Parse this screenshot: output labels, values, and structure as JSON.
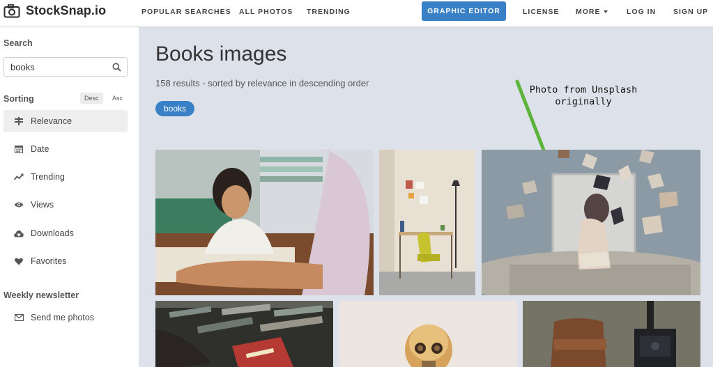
{
  "app": {
    "logo_text": "StockSnap.io"
  },
  "nav": {
    "popular": "POPULAR SEARCHES",
    "all_photos": "ALL PHOTOS",
    "trending": "TRENDING",
    "graphic_editor": "GRAPHIC EDITOR",
    "license": "LICENSE",
    "more": "MORE",
    "login": "LOG IN",
    "signup": "SIGN UP"
  },
  "sidebar": {
    "search_heading": "Search",
    "search_value": "books",
    "sorting_heading": "Sorting",
    "desc": "Desc",
    "asc": "Asc",
    "sort_items": [
      {
        "label": "Relevance",
        "icon": "relevance-icon",
        "active": true
      },
      {
        "label": "Date",
        "icon": "calendar-icon"
      },
      {
        "label": "Trending",
        "icon": "trending-icon"
      },
      {
        "label": "Views",
        "icon": "eye-icon"
      },
      {
        "label": "Downloads",
        "icon": "cloud-download-icon"
      },
      {
        "label": "Favorites",
        "icon": "heart-icon"
      }
    ],
    "newsletter_heading": "Weekly newsletter",
    "newsletter_item": "Send me photos"
  },
  "main": {
    "title": "Books images",
    "results_text": "158 results - sorted by relevance in descending order",
    "tag": "books",
    "annotation": "Photo from Unsplash originally"
  },
  "colors": {
    "accent": "#3a80c7",
    "annotation_arrow": "#5db33a",
    "main_bg": "#dde2ea"
  }
}
